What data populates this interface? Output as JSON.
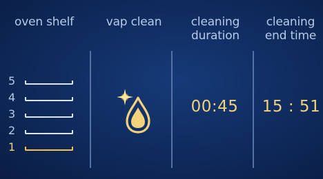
{
  "headers": {
    "oven_shelf": "oven shelf",
    "vap_clean": "vap clean",
    "cleaning_duration_line1": "cleaning",
    "cleaning_duration_line2": "duration",
    "cleaning_end_line1": "cleaning",
    "cleaning_end_line2": "end time"
  },
  "shelves": [
    {
      "number": "5",
      "active": false
    },
    {
      "number": "4",
      "active": false
    },
    {
      "number": "3",
      "active": false
    },
    {
      "number": "2",
      "active": false
    },
    {
      "number": "1",
      "active": true
    }
  ],
  "vap_clean_icon": "water-drop-sparkle-icon",
  "cleaning_duration": "00:45",
  "cleaning_end_time": "15 : 51",
  "colors": {
    "background": "#0f2a5c",
    "label": "#b7c9e8",
    "accent": "#f2d27a",
    "shelf_inactive": "#dce6f6",
    "divider": "#5f7fb2"
  }
}
